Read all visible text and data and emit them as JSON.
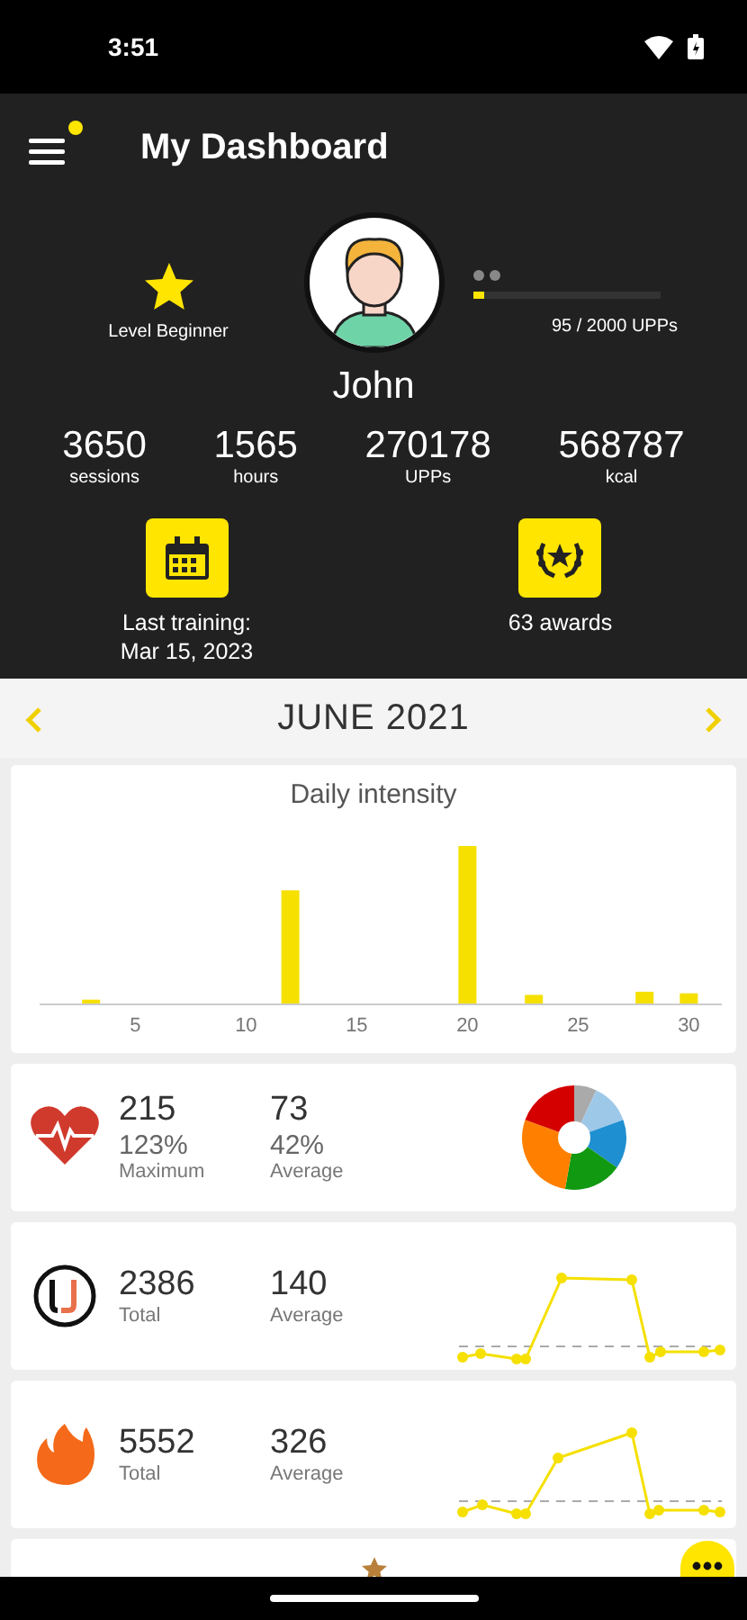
{
  "status_bar": {
    "time": "3:51"
  },
  "header": {
    "title": "My Dashboard",
    "menu_notification": true
  },
  "profile": {
    "level_label": "Level Beginner",
    "name": "John",
    "progress": {
      "level": 0.0475,
      "label": "95 / 2000 UPPs"
    }
  },
  "stats": [
    {
      "value": "3650",
      "label": "sessions"
    },
    {
      "value": "1565",
      "label": "hours"
    },
    {
      "value": "270178",
      "label": "UPPs"
    },
    {
      "value": "568787",
      "label": "kcal"
    }
  ],
  "shortcuts": [
    {
      "kind": "calendar",
      "label": "Last training:\nMar 15, 2023"
    },
    {
      "kind": "awards",
      "label": "63 awards"
    }
  ],
  "month_nav": {
    "title": "JUNE 2021"
  },
  "intensity_chart": {
    "title": "Daily intensity",
    "axis_labels": [
      "5",
      "10",
      "15",
      "20",
      "25",
      "30"
    ]
  },
  "metric_cards": [
    {
      "kind": "heart",
      "primary": {
        "value": "215",
        "sub": "123%",
        "label": "Maximum"
      },
      "secondary": {
        "value": "73",
        "sub": "42%",
        "label": "Average"
      }
    },
    {
      "kind": "upps",
      "primary": {
        "value": "2386",
        "label": "Total"
      },
      "secondary": {
        "value": "140",
        "label": "Average"
      }
    },
    {
      "kind": "calories",
      "primary": {
        "value": "5552",
        "label": "Total"
      },
      "secondary": {
        "value": "326",
        "label": "Average"
      }
    }
  ]
}
